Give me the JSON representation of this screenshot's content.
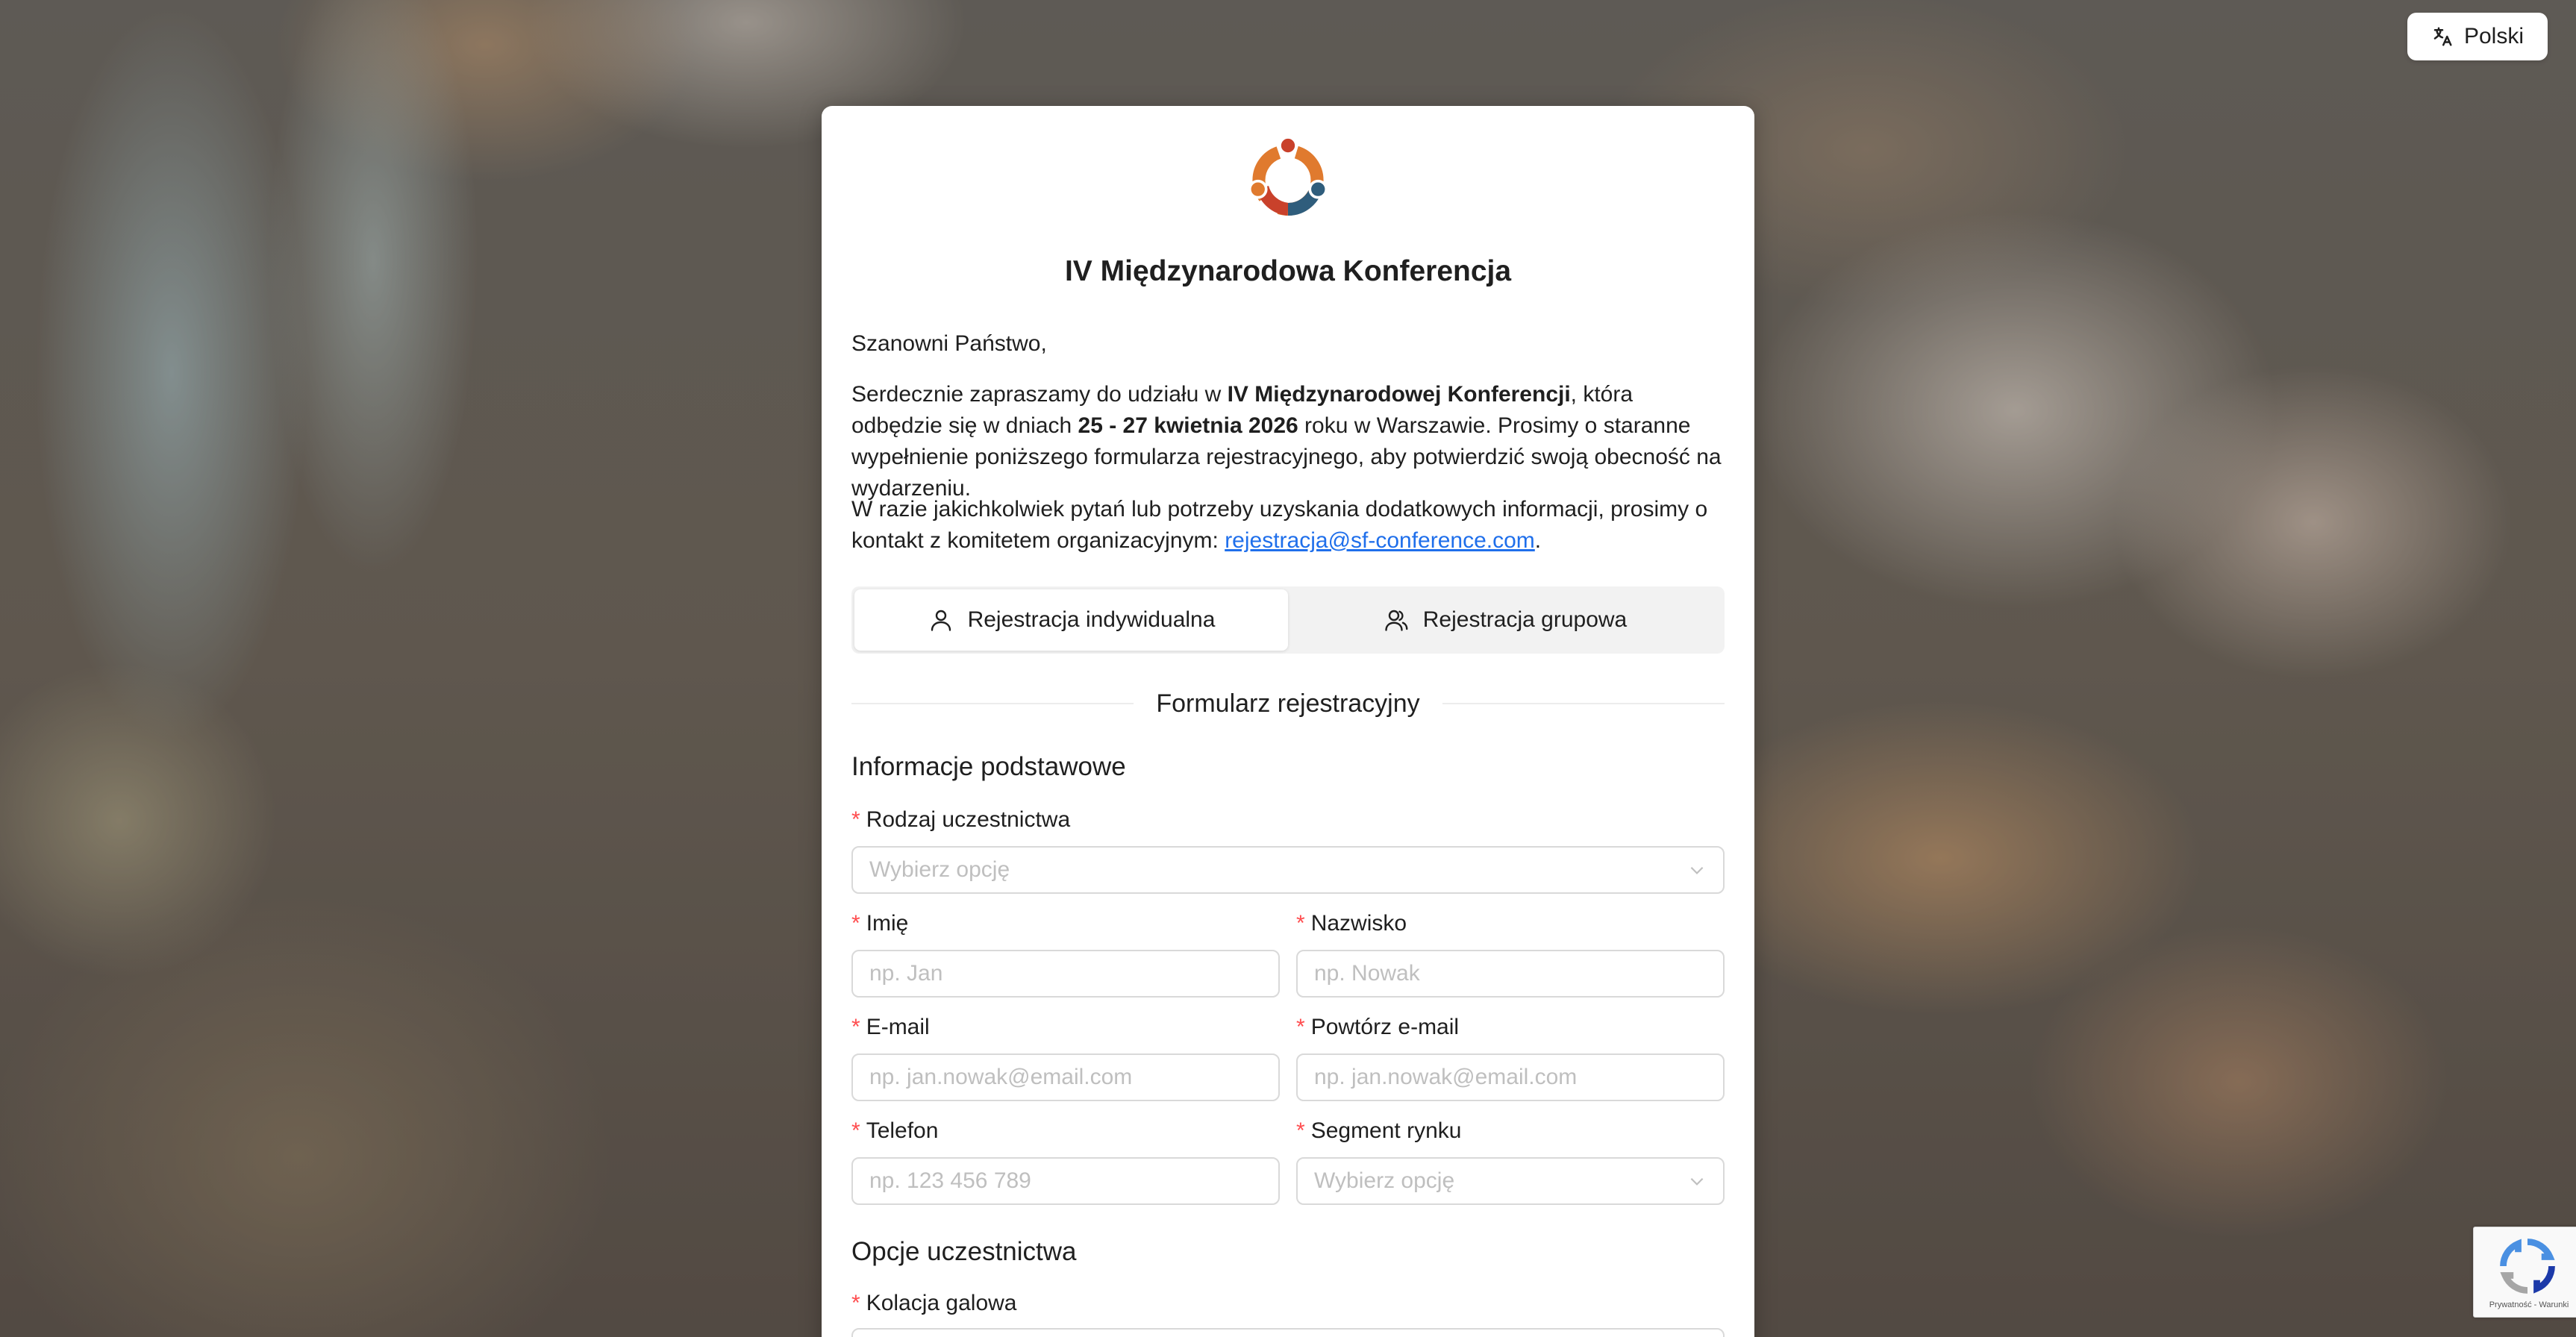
{
  "language": {
    "label": "Polski",
    "icon": "translate-icon"
  },
  "card": {
    "title": "IV Międzynarodowa Konferencja",
    "greeting": "Szanowni Państwo,",
    "intro": {
      "p1_a": "Serdecznie zapraszamy do udziału w ",
      "p1_b": "IV Międzynarodowej Konferencji",
      "p1_c": ", która odbędzie się w dniach ",
      "p1_d": "25 - 27 kwietnia 2026",
      "p1_e": " roku w Warszawie. Prosimy o staranne wypełnienie poniższego formularza rejestracyjnego, aby potwierdzić swoją obecność na wydarzeniu.",
      "p2_a": "W razie jakichkolwiek pytań lub potrzeby uzyskania dodatkowych informacji, prosimy o kontakt z komitetem organizacyjnym: ",
      "p2_link": "rejestracja@sf-conference.com",
      "p2_end": "."
    },
    "tabs": [
      {
        "label": "Rejestracja indywidualna",
        "active": true,
        "icon": "user-icon"
      },
      {
        "label": "Rejestracja grupowa",
        "active": false,
        "icon": "users-icon"
      }
    ],
    "form_title": "Formularz rejestracyjny",
    "section_basic": "Informacje podstawowe",
    "section_options": "Opcje uczestnictwa",
    "fields": {
      "participation": {
        "label": "Rodzaj uczestnictwa",
        "placeholder": "Wybierz opcję"
      },
      "first_name": {
        "label": "Imię",
        "placeholder": "np. Jan"
      },
      "last_name": {
        "label": "Nazwisko",
        "placeholder": "np. Nowak"
      },
      "email": {
        "label": "E-mail",
        "placeholder": "np. jan.nowak@email.com"
      },
      "email_repeat": {
        "label": "Powtórz e-mail",
        "placeholder": "np. jan.nowak@email.com"
      },
      "phone": {
        "label": "Telefon",
        "placeholder": "np. 123 456 789"
      },
      "segment": {
        "label": "Segment rynku",
        "placeholder": "Wybierz opcję"
      },
      "gala": {
        "label": "Kolacja galowa"
      }
    },
    "required_mark": "*"
  },
  "recaptcha": {
    "text": "Prywatność - Warunki"
  },
  "colors": {
    "link": "#1f6feb",
    "required": "#ff4d4f",
    "logo_orange": "#e07a2e",
    "logo_red": "#c9412b",
    "logo_blue": "#2f5d7c"
  }
}
